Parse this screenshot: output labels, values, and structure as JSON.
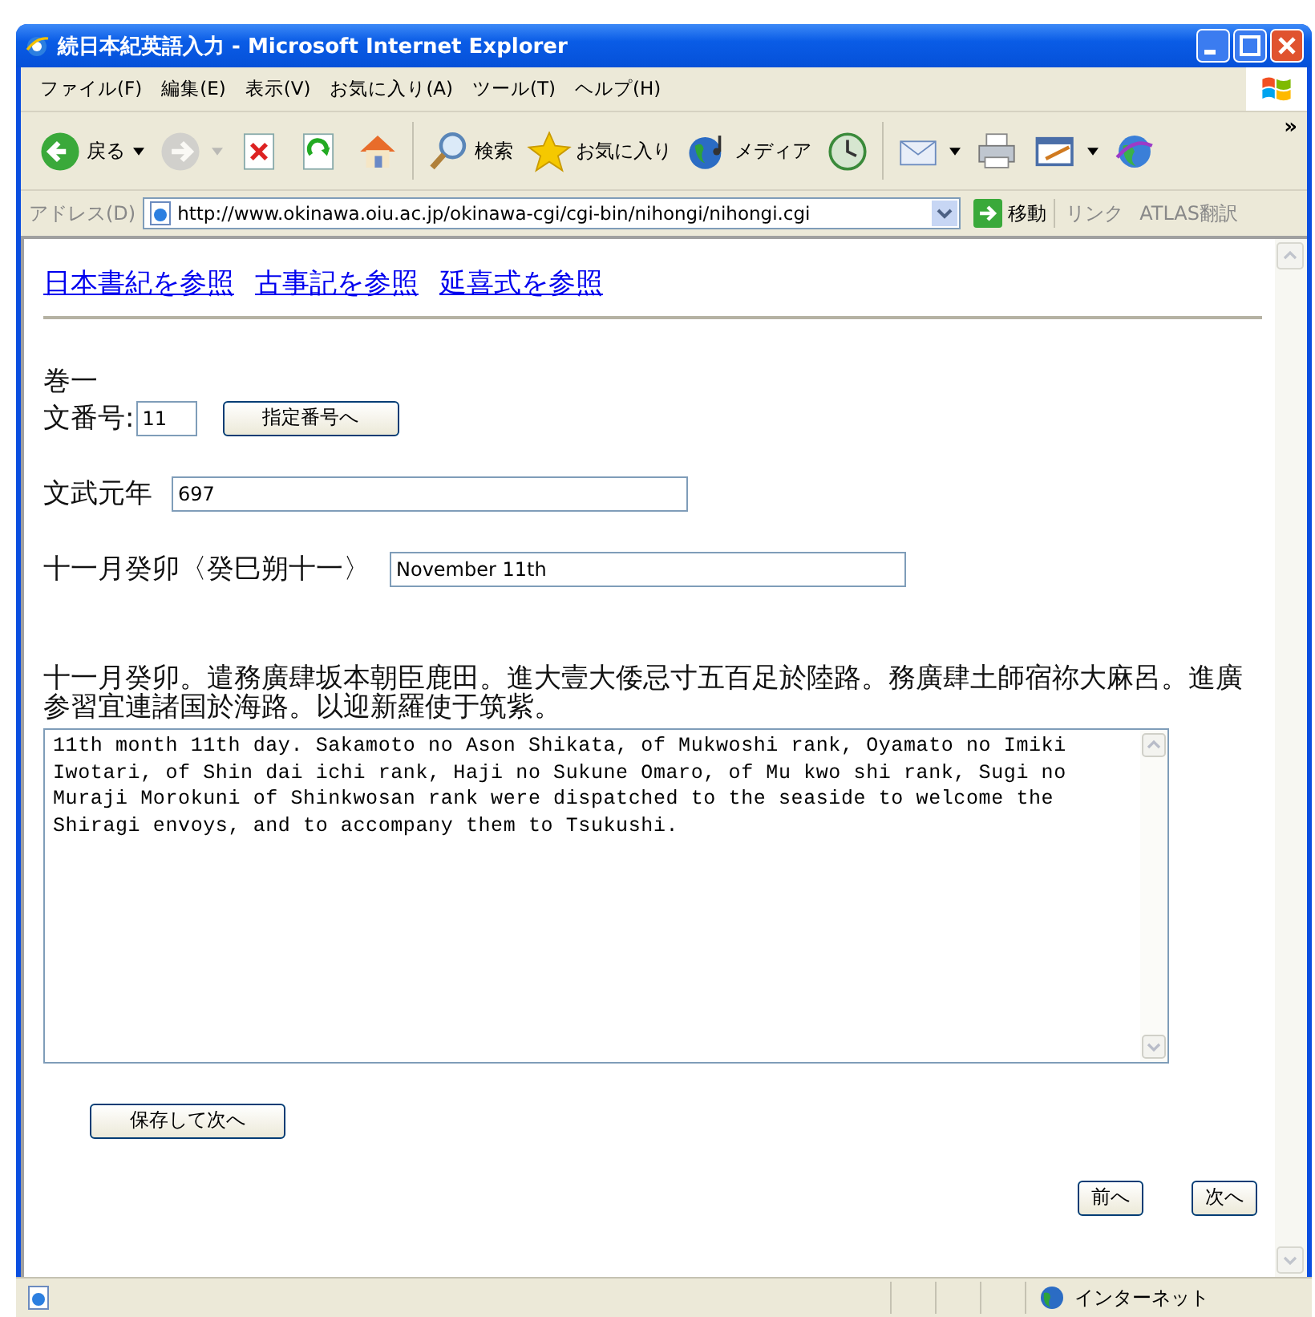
{
  "window": {
    "title": "続日本紀英語入力 - Microsoft Internet Explorer"
  },
  "menu": [
    "ファイル(F)",
    "編集(E)",
    "表示(V)",
    "お気に入り(A)",
    "ツール(T)",
    "ヘルプ(H)"
  ],
  "toolbar": [
    {
      "kind": "back",
      "label": "戻る",
      "dropdown": true,
      "disabled": false
    },
    {
      "kind": "forward",
      "dropdown": true,
      "disabled": true
    },
    {
      "kind": "stop",
      "dropdown": false,
      "disabled": false
    },
    {
      "kind": "refresh",
      "dropdown": false,
      "disabled": false
    },
    {
      "kind": "home",
      "dropdown": false,
      "disabled": false
    },
    {
      "kind": "separator"
    },
    {
      "kind": "search",
      "label": "検索",
      "dropdown": false,
      "disabled": false
    },
    {
      "kind": "favorites",
      "label": "お気に入り",
      "dropdown": false,
      "disabled": false
    },
    {
      "kind": "media",
      "label": "メディア",
      "dropdown": false,
      "disabled": false
    },
    {
      "kind": "history",
      "dropdown": false,
      "disabled": false
    },
    {
      "kind": "separator"
    },
    {
      "kind": "mail",
      "dropdown": true,
      "disabled": false
    },
    {
      "kind": "print",
      "dropdown": false,
      "disabled": false
    },
    {
      "kind": "edit",
      "dropdown": true,
      "disabled": false
    },
    {
      "kind": "messenger",
      "dropdown": false,
      "disabled": false
    }
  ],
  "toolbar_overflow": "»",
  "address": {
    "label": "アドレス(D)",
    "url": "http://www.okinawa.oiu.ac.jp/okinawa-cgi/cgi-bin/nihongi/nihongi.cgi",
    "go": "移動",
    "links": "リンク",
    "extra": "ATLAS翻訳"
  },
  "page": {
    "links": [
      "日本書紀を参照",
      "古事記を参照",
      "延喜式を参照"
    ],
    "volume": "巻一",
    "number": {
      "label": "文番号:",
      "value": "11",
      "button": "指定番号へ"
    },
    "era": {
      "label": "文武元年",
      "value": "697"
    },
    "date": {
      "label": "十一月癸卯〈癸巳朔十一〉",
      "value": "November 11th"
    },
    "original": "十一月癸卯。遣務廣肆坂本朝臣鹿田。進大壹大倭忌寸五百足於陸路。務廣肆土師宿祢大麻呂。進廣参習宜連諸国於海路。以迎新羅使于筑紫。",
    "translation": "11th month 11th day. Sakamoto no Ason Shikata, of Mukwoshi rank, Oyamato no Imiki Iwotari, of Shin dai ichi rank, Haji no Sukune Omaro, of Mu kwo shi rank, Sugi no Muraji Morokuni of Shinkwosan rank were dispatched to the seaside to welcome the Shiragi envoys, and to accompany them to Tsukushi.",
    "save": "保存して次へ",
    "prev": "前へ",
    "next": "次へ"
  },
  "status": {
    "zone": "インターネット"
  }
}
